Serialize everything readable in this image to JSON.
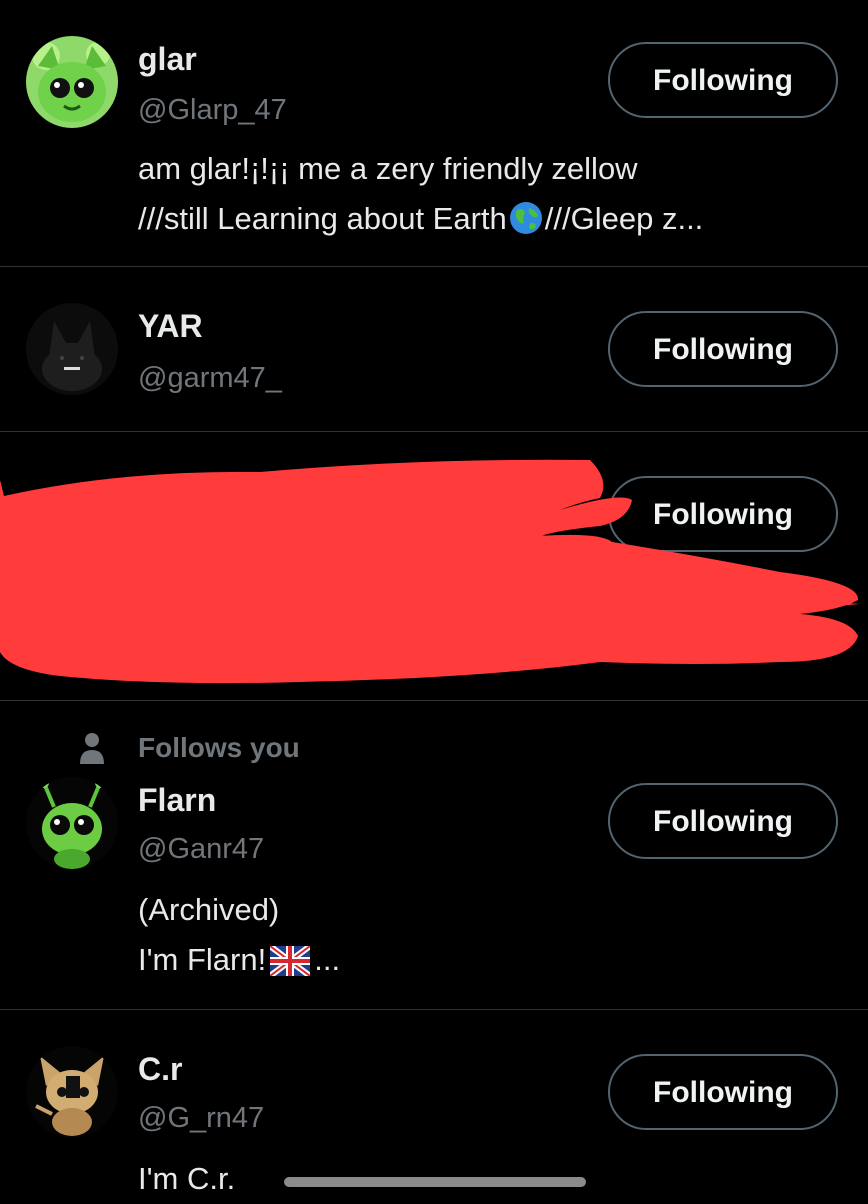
{
  "users": [
    {
      "name": "glar",
      "handle": "@Glarp_47",
      "bio_lines": [
        "am glar!¡!¡¡ me a zery friendly zellow",
        "///still Learning about Earth",
        "///Gleep z..."
      ],
      "follow_label": "Following",
      "avatar_icon": "green-alien-cat-icon"
    },
    {
      "name": "YAR",
      "handle": "@garm47_",
      "follow_label": "Following",
      "avatar_icon": "black-cat-icon"
    },
    {
      "redacted": true,
      "follow_label": "Following",
      "redaction_color": "#ff3b3b"
    },
    {
      "follows_you": "Follows you",
      "name": "Flarn",
      "handle": "@Ganr47",
      "bio_lines": [
        "(Archived)",
        "I'm Flarn!",
        "..."
      ],
      "follow_label": "Following",
      "avatar_icon": "green-alien-creature-icon"
    },
    {
      "name": "C.r",
      "handle": "@G_rn47",
      "bio_lines": [
        "I'm C.r."
      ],
      "follow_label": "Following",
      "avatar_icon": "tan-creature-icon"
    }
  ],
  "colors": {
    "background": "#000000",
    "primary_text": "#e7e9ea",
    "secondary_text": "#71767b",
    "button_border": "#536471",
    "divider": "#2f3336"
  }
}
